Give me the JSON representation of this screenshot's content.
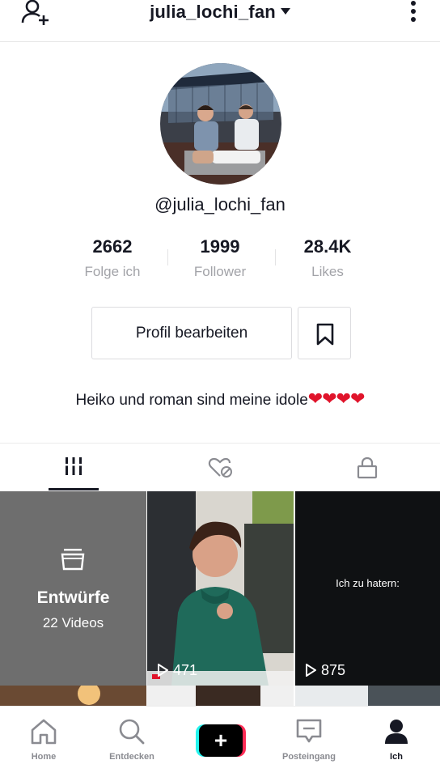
{
  "header": {
    "title": "julia_lochi_fan"
  },
  "profile": {
    "username": "@julia_lochi_fan",
    "stats": [
      {
        "value": "2662",
        "label": "Folge ich"
      },
      {
        "value": "1999",
        "label": "Follower"
      },
      {
        "value": "28.4K",
        "label": "Likes"
      }
    ],
    "edit_label": "Profil bearbeiten",
    "bio_text": "Heiko und roman sind meine idole",
    "bio_hearts": "❤❤❤❤"
  },
  "grid": {
    "drafts_title": "Entwürfe",
    "drafts_count": "22 Videos",
    "videos": [
      {
        "views": "471"
      },
      {
        "views": "875",
        "caption": "Ich zu hatern:"
      }
    ]
  },
  "nav": {
    "items": [
      {
        "label": "Home",
        "icon": "home-icon"
      },
      {
        "label": "Entdecken",
        "icon": "search-icon"
      },
      {
        "label": "",
        "icon": "plus-icon"
      },
      {
        "label": "Posteingang",
        "icon": "inbox-icon"
      },
      {
        "label": "Ich",
        "icon": "profile-icon"
      }
    ]
  },
  "colors": {
    "accent_cyan": "#25f4ee",
    "accent_red": "#fe2c55",
    "heart": "#e0142b"
  }
}
